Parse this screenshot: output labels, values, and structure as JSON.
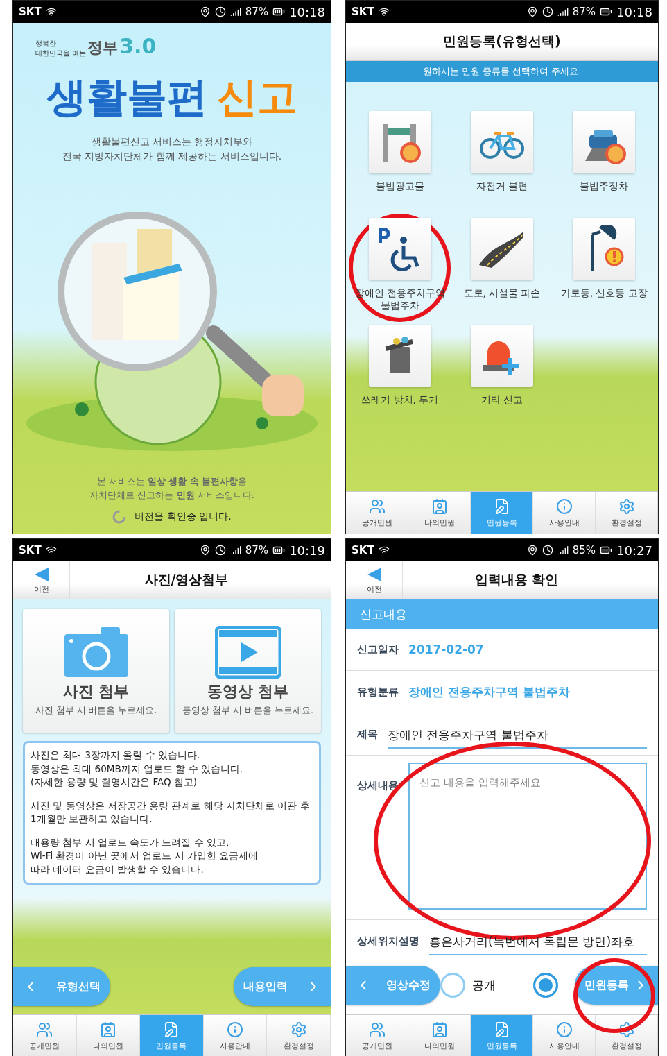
{
  "screens": [
    {
      "kind": "splash",
      "status_bar": {
        "carrier": "SKT",
        "battery": "87%",
        "time": "10:18"
      },
      "logo": {
        "tagline_1": "행복한",
        "tagline_2": "대한민국을 여는",
        "name": "정부",
        "version": "3.0"
      },
      "title": {
        "main": "생활불편",
        "accent": "신고"
      },
      "intro": [
        "생활불편신고 서비스는 행정자치부와",
        "전국 지방자치단체가 함께 제공하는 서비스입니다."
      ],
      "footer": [
        "본 서비스는 **일상 생활 속 불편사항**을",
        "자치단체로 신고하는 **민원** 서비스입니다."
      ],
      "loading": "버전을 확인중 입니다."
    },
    {
      "kind": "type_select",
      "status_bar": {
        "carrier": "SKT",
        "battery": "87%",
        "time": "10:18"
      },
      "title": "민원등록(유형선택)",
      "banner": "원하시는 민원 종류를 선택하여 주세요.",
      "tiles": [
        {
          "label": "불법광고물",
          "highlighted": false
        },
        {
          "label": "자전거 불편",
          "highlighted": false
        },
        {
          "label": "불법주정차",
          "highlighted": false
        },
        {
          "label": "장애인 전용주차구역 불법주차",
          "highlighted": true
        },
        {
          "label": "도로, 시설물 파손",
          "highlighted": false
        },
        {
          "label": "가로등, 신호등 고장",
          "highlighted": false
        },
        {
          "label": "쓰레기 방치, 투기",
          "highlighted": false
        },
        {
          "label": "기타 신고",
          "highlighted": false
        }
      ],
      "tabs": [
        {
          "label": "공개민원",
          "selected": false
        },
        {
          "label": "나의민원",
          "selected": false
        },
        {
          "label": "민원등록",
          "selected": true
        },
        {
          "label": "사용안내",
          "selected": false
        },
        {
          "label": "환경설정",
          "selected": false
        }
      ]
    },
    {
      "kind": "attachment",
      "status_bar": {
        "carrier": "SKT",
        "battery": "87%",
        "time": "10:19"
      },
      "back": "이전",
      "title": "사진/영상첨부",
      "cards": [
        {
          "title": "사진 첨부",
          "hint": "사진 첨부 시 버튼을 누르세요."
        },
        {
          "title": "동영상 첨부",
          "hint": "동영상 첨부 시 버튼을 누르세요."
        }
      ],
      "notice": [
        [
          "사진은 최대 3장까지 올릴 수 있습니다.",
          "동영상은 최대 60MB까지 업로드 할 수 있습니다.",
          "(자세한 용량 및 촬영시간은 FAQ 참고)"
        ],
        [
          "사진 및 동영상은 저장공간 용량 관계로 해당 자치단체로 이관 후 1개월만 보관하고 있습니다."
        ],
        [
          "대용량 첨부 시 업로드 속도가 느려질 수 있고,",
          "Wi-Fi 환경이 아닌 곳에서 업로드 시 가입한 요금제에",
          "따라 데이터 요금이 발생할 수  있습니다."
        ]
      ],
      "prev": "유형선택",
      "next": "내용입력",
      "tabs": [
        {
          "label": "공개민원",
          "selected": false
        },
        {
          "label": "나의민원",
          "selected": false
        },
        {
          "label": "민원등록",
          "selected": true
        },
        {
          "label": "사용안내",
          "selected": false
        },
        {
          "label": "환경설정",
          "selected": false
        }
      ]
    },
    {
      "kind": "confirm",
      "status_bar": {
        "carrier": "SKT",
        "battery": "85%",
        "time": "10:27"
      },
      "back": "이전",
      "title": "입력내용 확인",
      "section": "신고내용",
      "fields": [
        {
          "kind": "text",
          "label": "신고일자",
          "value": "2017-02-07"
        },
        {
          "kind": "text",
          "label": "유형분류",
          "value": "장애인 전용주차구역 불법주차"
        },
        {
          "kind": "input",
          "label": "제목",
          "value": "장애인 전용주차구역 불법주차"
        },
        {
          "kind": "textarea",
          "label": "상세내용",
          "placeholder": "신고 내용을 입력해주세요",
          "highlighted": true
        },
        {
          "kind": "input",
          "label": "상세위치설명",
          "value": "홍은사거리(녹번에서 독립문 방면)좌호"
        }
      ],
      "prev": "영상수정",
      "options": [
        {
          "label": "공개",
          "selected": false
        },
        {
          "selected": true
        }
      ],
      "next": "민원등록",
      "next_highlighted": true,
      "tabs": [
        {
          "label": "공개민원",
          "selected": false
        },
        {
          "label": "나의민원",
          "selected": false
        },
        {
          "label": "민원등록",
          "selected": true
        },
        {
          "label": "사용안내",
          "selected": false
        },
        {
          "label": "환경설정",
          "selected": false
        }
      ]
    }
  ]
}
